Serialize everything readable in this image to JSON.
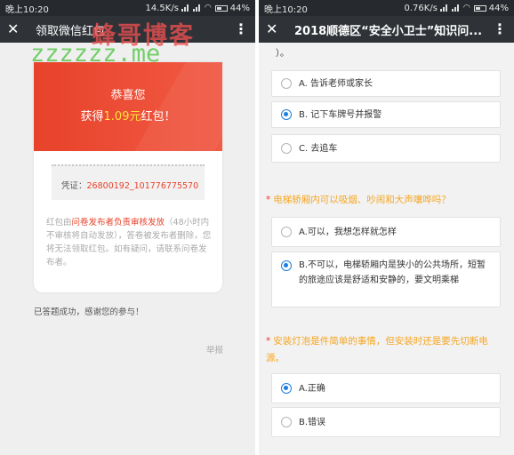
{
  "left": {
    "status": {
      "time": "晚上10:20",
      "speed": "14.5K/s",
      "battery": "44%"
    },
    "nav": {
      "title": "领取微信红包"
    },
    "watermark": {
      "cn": "蜂哥博客",
      "url": "zzzzzz.me"
    },
    "card": {
      "congrats": "恭喜您",
      "amount_prefix": "获得",
      "amount": "1.09元",
      "amount_suffix": "红包！",
      "voucher_label": "凭证：",
      "voucher_value": "26800192_101776775570",
      "note_prefix": "红包由",
      "note_highlight": "问卷发布者负责审核发放",
      "note_rest": "（48小时内不审核将自动发放），答卷被发布者删除，您将无法领取红包。如有疑问，请联系问卷发布者。"
    },
    "done_text": "已答题成功，感谢您的参与！",
    "report_label": "举报"
  },
  "right": {
    "status": {
      "time": "晚上10:20",
      "speed": "0.76K/s",
      "battery": "44%"
    },
    "nav": {
      "title": "2018顺德区“安全小卫士”知识问..."
    },
    "prev_question_tail": "）。",
    "q1_options": [
      {
        "label": "A. 告诉老师或家长",
        "selected": false
      },
      {
        "label": "B. 记下车牌号并报警",
        "selected": true
      },
      {
        "label": "C. 去追车",
        "selected": false
      }
    ],
    "q2": {
      "text": "电梯轿厢内可以吸烟、吵闹和大声嚷哗吗？",
      "options": [
        {
          "label": "A.可以，我想怎样就怎样",
          "selected": false
        },
        {
          "label": "B.不可以，电梯轿厢内是狭小的公共场所，短暂的旅途应该是舒适和安静的，要文明乘梯",
          "selected": true
        }
      ]
    },
    "q3": {
      "text": "安装灯泡是件简单的事情，但安装时还是要先切断电源。",
      "options": [
        {
          "label": "A.正确",
          "selected": true
        },
        {
          "label": "B.错误",
          "selected": false
        }
      ]
    }
  },
  "colors": {
    "accent_red": "#e8422a",
    "question_orange": "#f5a623",
    "radio_blue": "#1a7fe0",
    "navbar": "#2f3338"
  }
}
